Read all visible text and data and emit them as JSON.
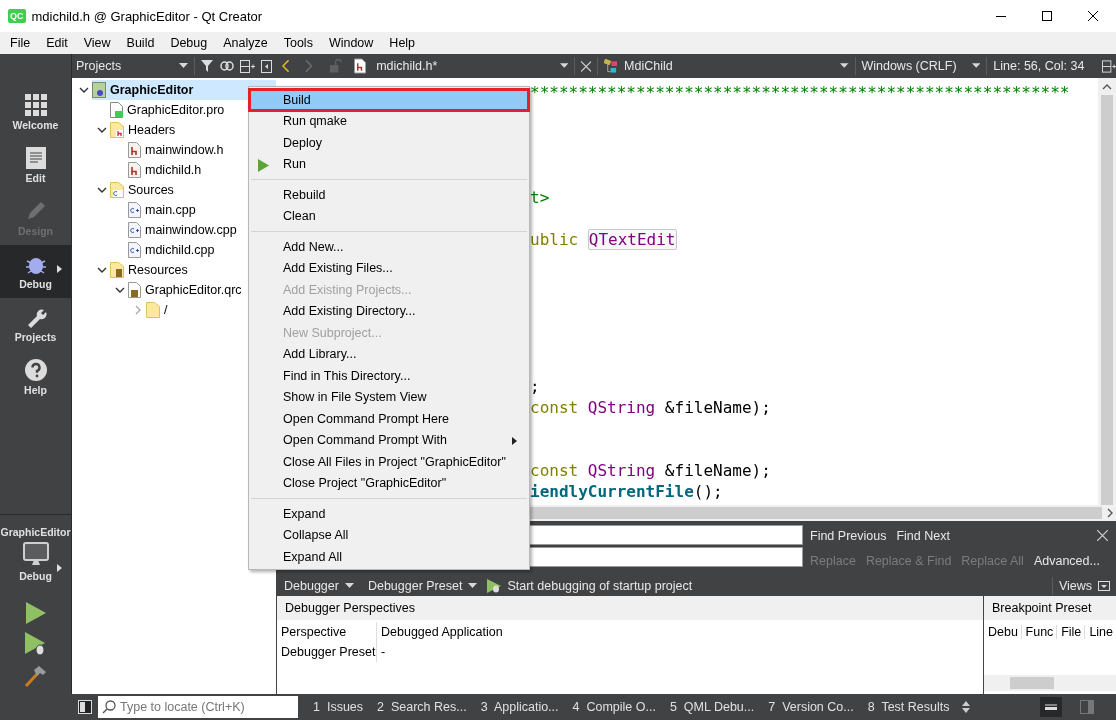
{
  "window": {
    "app_icon": "QC",
    "title": "mdichild.h @ GraphicEditor - Qt Creator"
  },
  "menu_bar": [
    "File",
    "Edit",
    "View",
    "Build",
    "Debug",
    "Analyze",
    "Tools",
    "Window",
    "Help"
  ],
  "mode_bar": {
    "modes": [
      {
        "label": "Welcome",
        "kind": "welcome",
        "selected": false,
        "disabled": false
      },
      {
        "label": "Edit",
        "kind": "edit",
        "selected": false,
        "disabled": false
      },
      {
        "label": "Design",
        "kind": "design",
        "selected": false,
        "disabled": true
      },
      {
        "label": "Debug",
        "kind": "debug",
        "selected": true,
        "disabled": false
      },
      {
        "label": "Projects",
        "kind": "projects",
        "selected": false,
        "disabled": false
      },
      {
        "label": "Help",
        "kind": "help",
        "selected": false,
        "disabled": false
      }
    ],
    "kit": {
      "project": "GraphicEditor",
      "build": "Debug"
    }
  },
  "projects_pane": {
    "title": "Projects",
    "tree": [
      {
        "label": "GraphicEditor",
        "kind": "project",
        "expanded": true,
        "selected": true,
        "children": [
          {
            "label": "GraphicEditor.pro",
            "kind": "pro",
            "selected": false
          },
          {
            "label": "Headers",
            "kind": "headers",
            "expanded": true,
            "selected": false,
            "children": [
              {
                "label": "mainwindow.h",
                "kind": "header",
                "selected": false
              },
              {
                "label": "mdichild.h",
                "kind": "header",
                "selected": false
              }
            ]
          },
          {
            "label": "Sources",
            "kind": "sources",
            "expanded": true,
            "selected": false,
            "children": [
              {
                "label": "main.cpp",
                "kind": "source",
                "selected": false
              },
              {
                "label": "mainwindow.cpp",
                "kind": "source",
                "selected": false
              },
              {
                "label": "mdichild.cpp",
                "kind": "source",
                "selected": false
              }
            ]
          },
          {
            "label": "Resources",
            "kind": "resources",
            "expanded": true,
            "selected": false,
            "children": [
              {
                "label": "GraphicEditor.qrc",
                "kind": "qrc",
                "expanded": true,
                "selected": false,
                "children": [
                  {
                    "label": "/",
                    "kind": "folder",
                    "expanded": false,
                    "selected": false
                  }
                ]
              }
            ]
          }
        ]
      }
    ]
  },
  "editor": {
    "file_name": "mdichild.h*",
    "symbol": "MdiChild",
    "line_ending": "Windows (CRLF)",
    "cursor": "Line: 56, Col: 34",
    "lines": [
      {
        "kind": "code",
        "tokens": [
          {
            "text": "********************************************************",
            "kind": "comment"
          }
        ]
      },
      {
        "kind": "hidden"
      },
      {
        "kind": "hidden"
      },
      {
        "kind": "hidden"
      },
      {
        "kind": "hidden"
      },
      {
        "kind": "code",
        "tokens": [
          {
            "text": "t>",
            "kind": "include"
          }
        ]
      },
      {
        "kind": "hidden"
      },
      {
        "kind": "code",
        "tokens": [
          {
            "text": "ublic ",
            "kind": "keyword"
          },
          {
            "text": "QTextEdit",
            "kind": "type_marked"
          }
        ]
      },
      {
        "kind": "hidden"
      },
      {
        "kind": "hidden"
      },
      {
        "kind": "hidden"
      },
      {
        "kind": "hidden"
      },
      {
        "kind": "hidden"
      },
      {
        "kind": "hidden"
      },
      {
        "kind": "code",
        "tokens": [
          {
            "text": ";",
            "kind": "plain"
          }
        ]
      },
      {
        "kind": "code",
        "tokens": [
          {
            "text": "const ",
            "kind": "keyword"
          },
          {
            "text": "QString",
            "kind": "type"
          },
          {
            "text": " &fileName);",
            "kind": "plain"
          }
        ]
      },
      {
        "kind": "hidden"
      },
      {
        "kind": "hidden"
      },
      {
        "kind": "code",
        "tokens": [
          {
            "text": "const ",
            "kind": "keyword"
          },
          {
            "text": "QString",
            "kind": "type"
          },
          {
            "text": " &fileName);",
            "kind": "plain"
          }
        ]
      },
      {
        "kind": "code",
        "tokens": [
          {
            "text": "iendlyCurrentFile",
            "kind": "function"
          },
          {
            "text": "();",
            "kind": "plain"
          }
        ]
      }
    ]
  },
  "context_menu": {
    "items": [
      {
        "label": "Build",
        "kind": "item",
        "selected": true,
        "disabled": false
      },
      {
        "label": "Run qmake",
        "kind": "item",
        "selected": false,
        "disabled": false
      },
      {
        "label": "Deploy",
        "kind": "item",
        "selected": false,
        "disabled": false
      },
      {
        "label": "Run",
        "kind": "play_item",
        "selected": false,
        "disabled": false
      },
      {
        "kind": "separator"
      },
      {
        "label": "Rebuild",
        "kind": "item",
        "selected": false,
        "disabled": false
      },
      {
        "label": "Clean",
        "kind": "item",
        "selected": false,
        "disabled": false
      },
      {
        "kind": "separator"
      },
      {
        "label": "Add New...",
        "kind": "item",
        "selected": false,
        "disabled": false
      },
      {
        "label": "Add Existing Files...",
        "kind": "item",
        "selected": false,
        "disabled": false
      },
      {
        "label": "Add Existing Projects...",
        "kind": "item",
        "selected": false,
        "disabled": true
      },
      {
        "label": "Add Existing Directory...",
        "kind": "item",
        "selected": false,
        "disabled": false
      },
      {
        "label": "New Subproject...",
        "kind": "item",
        "selected": false,
        "disabled": true
      },
      {
        "label": "Add Library...",
        "kind": "item",
        "selected": false,
        "disabled": false
      },
      {
        "label": "Find in This Directory...",
        "kind": "item",
        "selected": false,
        "disabled": false
      },
      {
        "label": "Show in File System View",
        "kind": "item",
        "selected": false,
        "disabled": false
      },
      {
        "label": "Open Command Prompt Here",
        "kind": "item",
        "selected": false,
        "disabled": false
      },
      {
        "label": "Open Command Prompt With",
        "kind": "submenu_item",
        "selected": false,
        "disabled": false
      },
      {
        "label": "Close All Files in Project \"GraphicEditor\"",
        "kind": "item",
        "selected": false,
        "disabled": false
      },
      {
        "label": "Close Project \"GraphicEditor\"",
        "kind": "item",
        "selected": false,
        "disabled": false
      },
      {
        "kind": "separator"
      },
      {
        "label": "Expand",
        "kind": "item",
        "selected": false,
        "disabled": false
      },
      {
        "label": "Collapse All",
        "kind": "item",
        "selected": false,
        "disabled": false
      },
      {
        "label": "Expand All",
        "kind": "item",
        "selected": false,
        "disabled": false
      }
    ]
  },
  "find_bar": {
    "find_row": [
      {
        "label": "Find Previous",
        "disabled": false
      },
      {
        "label": "Find Next",
        "disabled": false
      }
    ],
    "replace_row": [
      {
        "label": "Replace",
        "disabled": true
      },
      {
        "label": "Replace & Find",
        "disabled": true
      },
      {
        "label": "Replace All",
        "disabled": true
      },
      {
        "label": "Advanced...",
        "disabled": false
      }
    ]
  },
  "debugger": {
    "toolbar": {
      "dropdowns": [
        "Debugger",
        "Debugger Preset"
      ],
      "start_label": "Start debugging of startup project",
      "views": "Views"
    },
    "perspectives": {
      "title": "Debugger Perspectives",
      "rows": [
        {
          "key": "Perspective",
          "value": "Debugged Application"
        },
        {
          "key": "Debugger Preset",
          "value": "-"
        }
      ]
    },
    "breakpoint_preset": {
      "title": "Breakpoint Preset",
      "columns": [
        "Debu",
        "Func",
        "File",
        "Line"
      ]
    }
  },
  "status_bar": {
    "locate_placeholder": "Type to locate (Ctrl+K)",
    "panes": [
      {
        "number": "1",
        "label": "Issues"
      },
      {
        "number": "2",
        "label": "Search Res..."
      },
      {
        "number": "3",
        "label": "Applicatio..."
      },
      {
        "number": "4",
        "label": "Compile O..."
      },
      {
        "number": "5",
        "label": "QML Debu..."
      },
      {
        "number": "7",
        "label": "Version Co..."
      },
      {
        "number": "8",
        "label": "Test Results"
      }
    ]
  }
}
